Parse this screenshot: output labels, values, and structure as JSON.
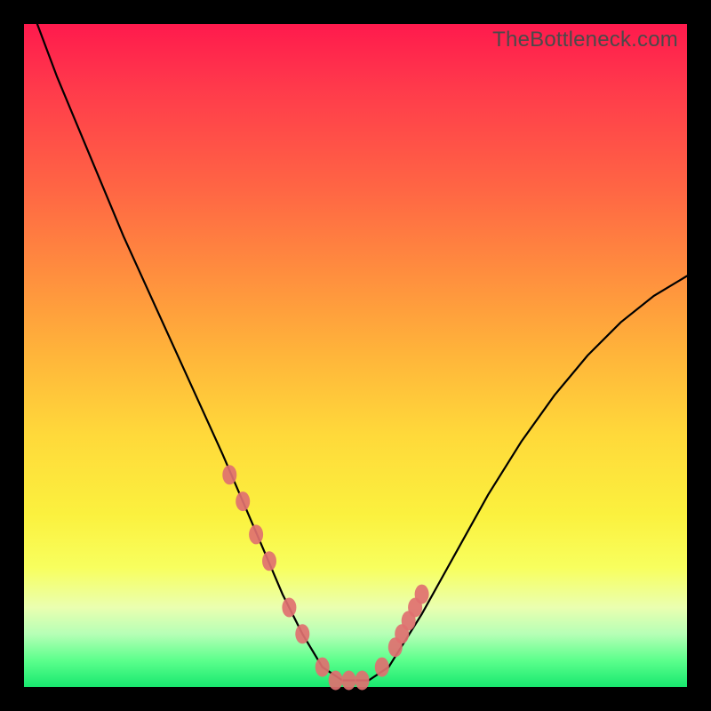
{
  "watermark": "TheBottleneck.com",
  "chart_data": {
    "type": "line",
    "title": "",
    "xlabel": "",
    "ylabel": "",
    "xlim": [
      0,
      100
    ],
    "ylim": [
      0,
      100
    ],
    "series": [
      {
        "name": "bottleneck-curve",
        "x": [
          2,
          5,
          10,
          15,
          20,
          25,
          30,
          33,
          36,
          39,
          42,
          45,
          48,
          50,
          52,
          55,
          60,
          65,
          70,
          75,
          80,
          85,
          90,
          95,
          100
        ],
        "y": [
          100,
          92,
          80,
          68,
          57,
          46,
          35,
          28,
          21,
          14,
          8,
          3,
          1,
          1,
          1,
          3,
          11,
          20,
          29,
          37,
          44,
          50,
          55,
          59,
          62
        ]
      }
    ],
    "markers": {
      "name": "highlight-points",
      "color": "#e07070",
      "x": [
        31,
        33,
        35,
        37,
        40,
        42,
        45,
        47,
        49,
        51,
        54,
        56,
        57,
        58,
        59,
        60
      ],
      "y": [
        32,
        28,
        23,
        19,
        12,
        8,
        3,
        1,
        1,
        1,
        3,
        6,
        8,
        10,
        12,
        14
      ]
    }
  }
}
